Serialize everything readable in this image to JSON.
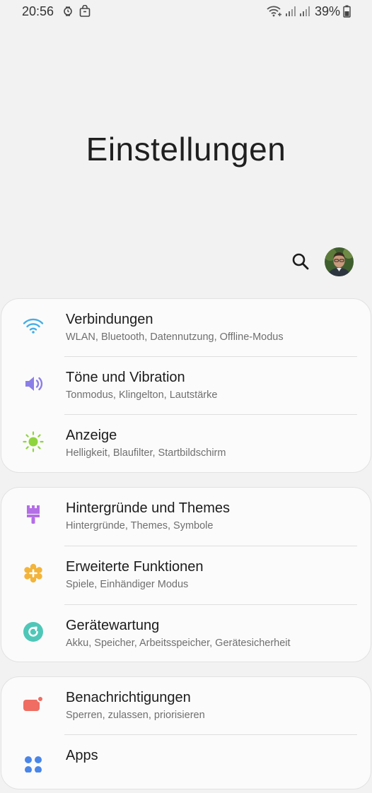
{
  "status_bar": {
    "time": "20:56",
    "battery": "39%",
    "icons_left": [
      "alarm-clock-icon",
      "bag-icon"
    ],
    "icons_right": [
      "wifi-plus-icon",
      "signal-icon",
      "signal-icon",
      "battery-icon"
    ]
  },
  "header": {
    "title": "Einstellungen",
    "search_icon": "search-icon",
    "avatar": "profile-avatar"
  },
  "groups": [
    {
      "items": [
        {
          "title": "Verbindungen",
          "subtitle": "WLAN, Bluetooth, Datennutzung, Offline-Modus",
          "icon": "wifi-icon",
          "color": "#45aee6"
        },
        {
          "title": "Töne und Vibration",
          "subtitle": "Tonmodus, Klingelton, Lautstärke",
          "icon": "speaker-icon",
          "color": "#8b7ee8"
        },
        {
          "title": "Anzeige",
          "subtitle": "Helligkeit, Blaufilter, Startbildschirm",
          "icon": "sun-icon",
          "color": "#8ed43c"
        }
      ]
    },
    {
      "items": [
        {
          "title": "Hintergründe und Themes",
          "subtitle": "Hintergründe, Themes, Symbole",
          "icon": "paintbrush-icon",
          "color": "#b46ee6"
        },
        {
          "title": "Erweiterte Funktionen",
          "subtitle": "Spiele, Einhändiger Modus",
          "icon": "gear-plus-icon",
          "color": "#f2b43a"
        },
        {
          "title": "Gerätewartung",
          "subtitle": "Akku, Speicher, Arbeitsspeicher, Gerätesicherheit",
          "icon": "refresh-circle-icon",
          "color": "#4fc7b8"
        }
      ]
    },
    {
      "items": [
        {
          "title": "Benachrichtigungen",
          "subtitle": "Sperren, zulassen, priorisieren",
          "icon": "notification-icon",
          "color": "#ef6d62"
        },
        {
          "title": "Apps",
          "subtitle": "",
          "icon": "apps-dots-icon",
          "color": "#4a86e8"
        }
      ]
    }
  ]
}
